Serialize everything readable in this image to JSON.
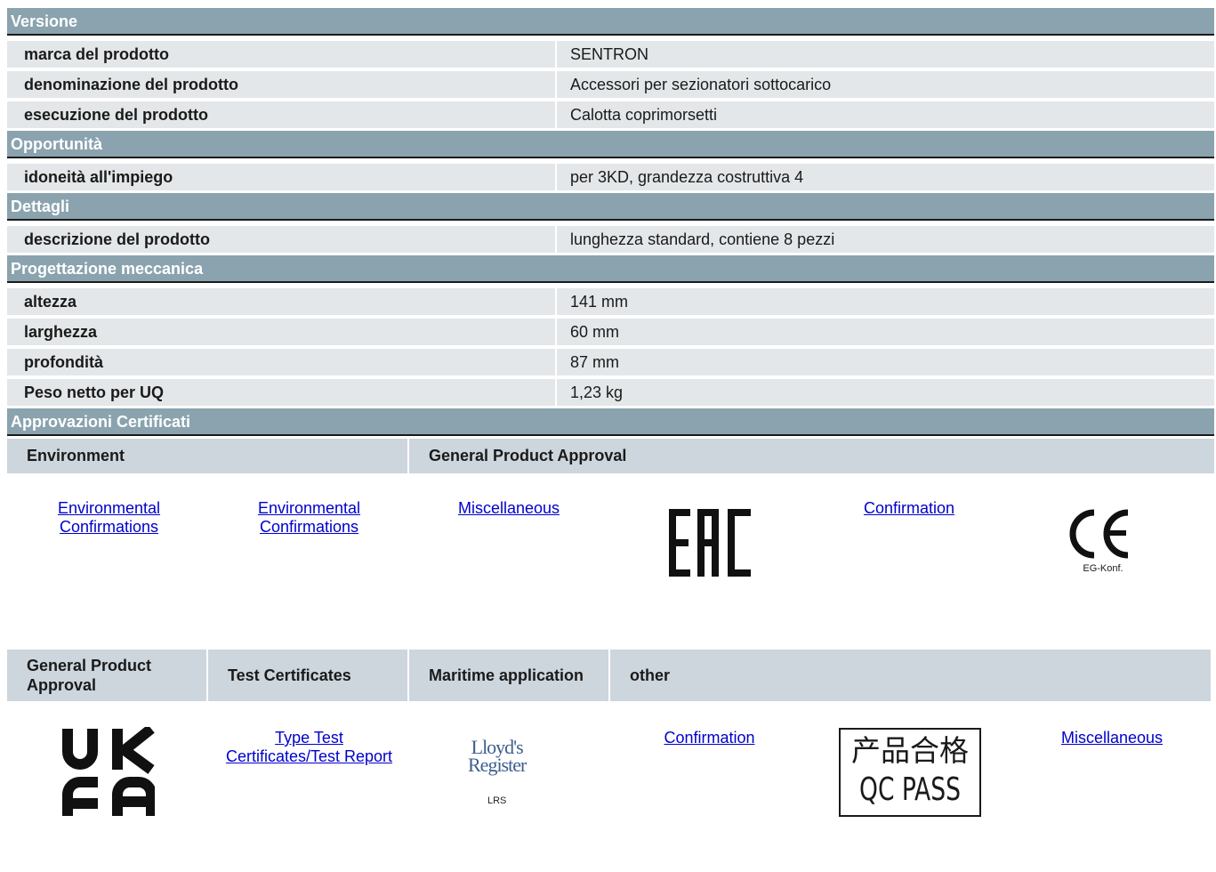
{
  "sections": {
    "versione": "Versione",
    "opportunita": "Opportunità",
    "dettagli": "Dettagli",
    "progettazione": "Progettazione meccanica",
    "approvazioni": "Approvazioni Certificati"
  },
  "rows": [
    {
      "key": "marca del prodotto",
      "value": "SENTRON"
    },
    {
      "key": "denominazione del prodotto",
      "value": "Accessori per sezionatori sottocarico"
    },
    {
      "key": "esecuzione del prodotto",
      "value": "Calotta coprimorsetti"
    },
    {
      "key": "idoneità all'impiego",
      "value": "per 3KD, grandezza costruttiva 4"
    },
    {
      "key": "descrizione del prodotto",
      "value": "lunghezza standard, contiene 8 pezzi"
    },
    {
      "key": "altezza",
      "value": "141 mm"
    },
    {
      "key": "larghezza",
      "value": "60 mm"
    },
    {
      "key": "profondità",
      "value": "87 mm"
    },
    {
      "key": "Peso netto per UQ",
      "value": "1,23 kg"
    }
  ],
  "cert_header_1": [
    "Environment",
    "General Product Approval"
  ],
  "cert_header_2": [
    "General Product Approval",
    "Test Certificates",
    "Maritime application",
    "other"
  ],
  "links_row_1": [
    "Environmental Confirmations",
    "Environmental Confirmations",
    "Miscellaneous",
    "Confirmation"
  ],
  "links_row_2": [
    "Type Test Certificates/Test Report",
    "Confirmation",
    "Miscellaneous"
  ],
  "logos": {
    "eac": "EAC",
    "ce": "CE",
    "ce_sub": "EG-Konf.",
    "ukca_1": "UK",
    "ukca_2": "CA",
    "lloyds_1": "Lloyd's",
    "lloyds_2": "Register",
    "lloyds_sub": "LRS",
    "qc_1": "产品合格",
    "qc_2": "QC PASS"
  },
  "colors": {
    "section_bg": "#8aa3ae",
    "row_bg": "#e4e7e9",
    "cert_head_bg": "#cdd6dd",
    "link": "#0000cc"
  }
}
